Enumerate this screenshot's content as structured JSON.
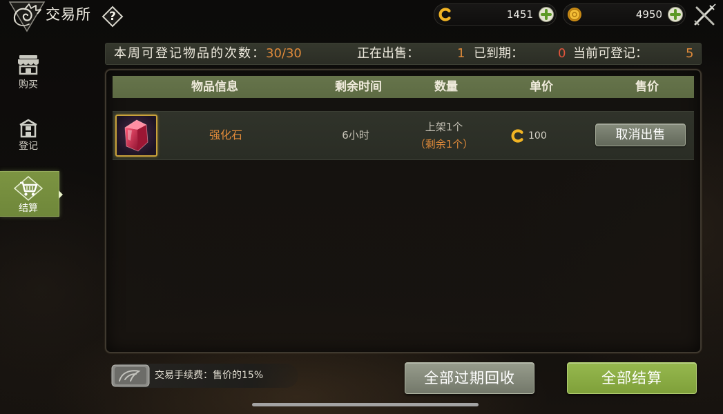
{
  "header": {
    "title": "交易所",
    "help_label": "?",
    "emblem_icon": "dragon-emblem-icon",
    "close_icon": "close-icon"
  },
  "currencies": [
    {
      "icon": "c-coin-icon",
      "amount": "1451",
      "add_icon": "plus-icon"
    },
    {
      "icon": "gold-coin-icon",
      "amount": "4950",
      "add_icon": "plus-icon"
    }
  ],
  "sidebar": {
    "items": [
      {
        "label": "购买",
        "icon": "shop-icon",
        "active": false
      },
      {
        "label": "登记",
        "icon": "register-icon",
        "active": false
      },
      {
        "label": "结算",
        "icon": "cart-icon",
        "active": true
      }
    ]
  },
  "stats": {
    "weekly_label": "本周可登记物品的次数：",
    "weekly_value": "30/30",
    "selling_label": "正在出售：",
    "selling_value": "1",
    "expired_label": "已到期：",
    "expired_value": "0",
    "available_label": "当前可登记：",
    "available_value": "5"
  },
  "table": {
    "columns": [
      "物品信息",
      "剩余时间",
      "数量",
      "单价",
      "售价"
    ],
    "rows": [
      {
        "item_icon": "red-crystal-icon",
        "item_name": "强化石",
        "time_left": "6小时",
        "quantity": "上架1个",
        "remaining": "（剩余1个）",
        "price_icon": "c-coin-icon",
        "unit_price": "100",
        "action_label": "取消出售"
      }
    ]
  },
  "footer": {
    "fee_icon": "stone-tile-icon",
    "fee_text": "交易手续费：售价的15%",
    "reclaim_label": "全部过期回收",
    "settle_all_label": "全部结算"
  },
  "colors": {
    "highlight_orange": "#e08a3a",
    "expired_red": "#e2553c",
    "header_green": "#5d6b43",
    "active_tab_green": "#6f873a",
    "settle_button_green": "#7fa03a",
    "item_frame_gold": "#c9a23a"
  }
}
